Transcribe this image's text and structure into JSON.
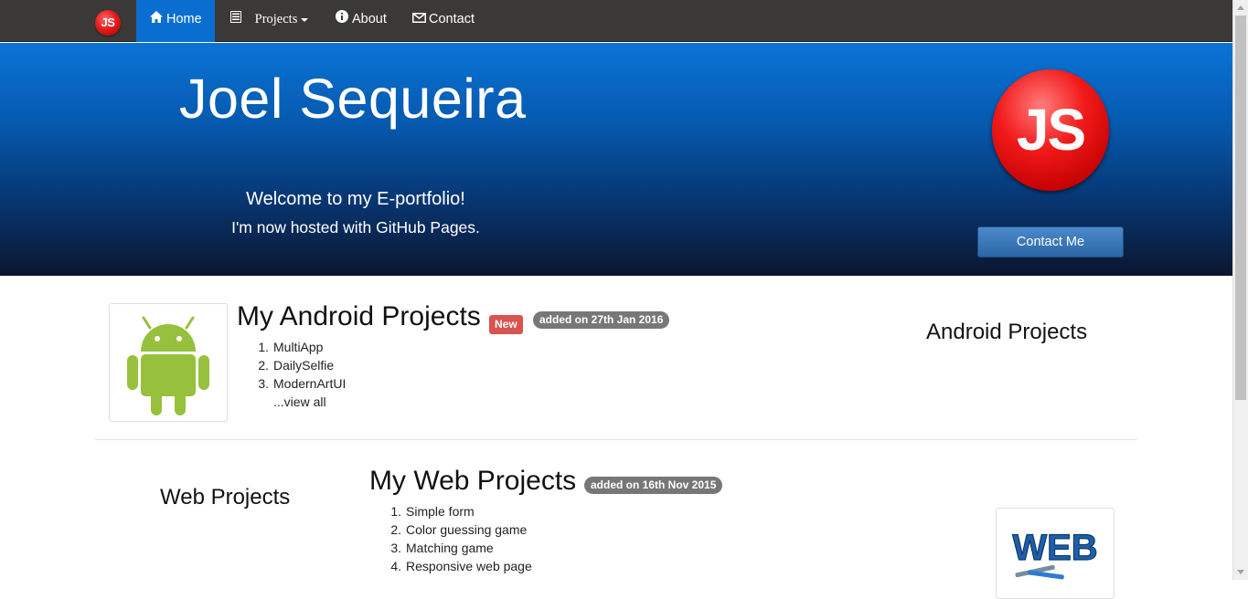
{
  "navbar": {
    "brand": "JS",
    "home": "Home",
    "projects": "Projects",
    "about": "About",
    "contact": "Contact"
  },
  "hero": {
    "title": "Joel Sequeira",
    "welcome": "Welcome to my E-portfolio!",
    "subtitle": "I'm now hosted with GitHub Pages.",
    "logo": "JS",
    "contact_button": "Contact Me"
  },
  "android": {
    "title": "My Android Projects",
    "badge_new": "New",
    "added": "added on 27th Jan 2016",
    "items": [
      {
        "num": "1.",
        "label": "MultiApp"
      },
      {
        "num": "2.",
        "label": "DailySelfie"
      },
      {
        "num": "3.",
        "label": "ModernArtUI"
      }
    ],
    "view_all": "...view all",
    "side_heading": "Android Projects"
  },
  "web": {
    "title": "My Web Projects",
    "added": "added on 16th Nov 2015",
    "items": [
      {
        "num": "1.",
        "label": "Simple form"
      },
      {
        "num": "2.",
        "label": "Color guessing game"
      },
      {
        "num": "3.",
        "label": "Matching game"
      },
      {
        "num": "4.",
        "label": "Responsive web page"
      }
    ],
    "side_heading": "Web Projects",
    "thumb_text": "WEB"
  },
  "colors": {
    "nav_bg": "#3b3938",
    "nav_active": "#0a6ed1",
    "hero_top": "#0a73d6",
    "hero_bottom": "#0b1630",
    "badge_new": "#d9534f",
    "badge_date": "#777777",
    "android_green": "#97c03d"
  }
}
